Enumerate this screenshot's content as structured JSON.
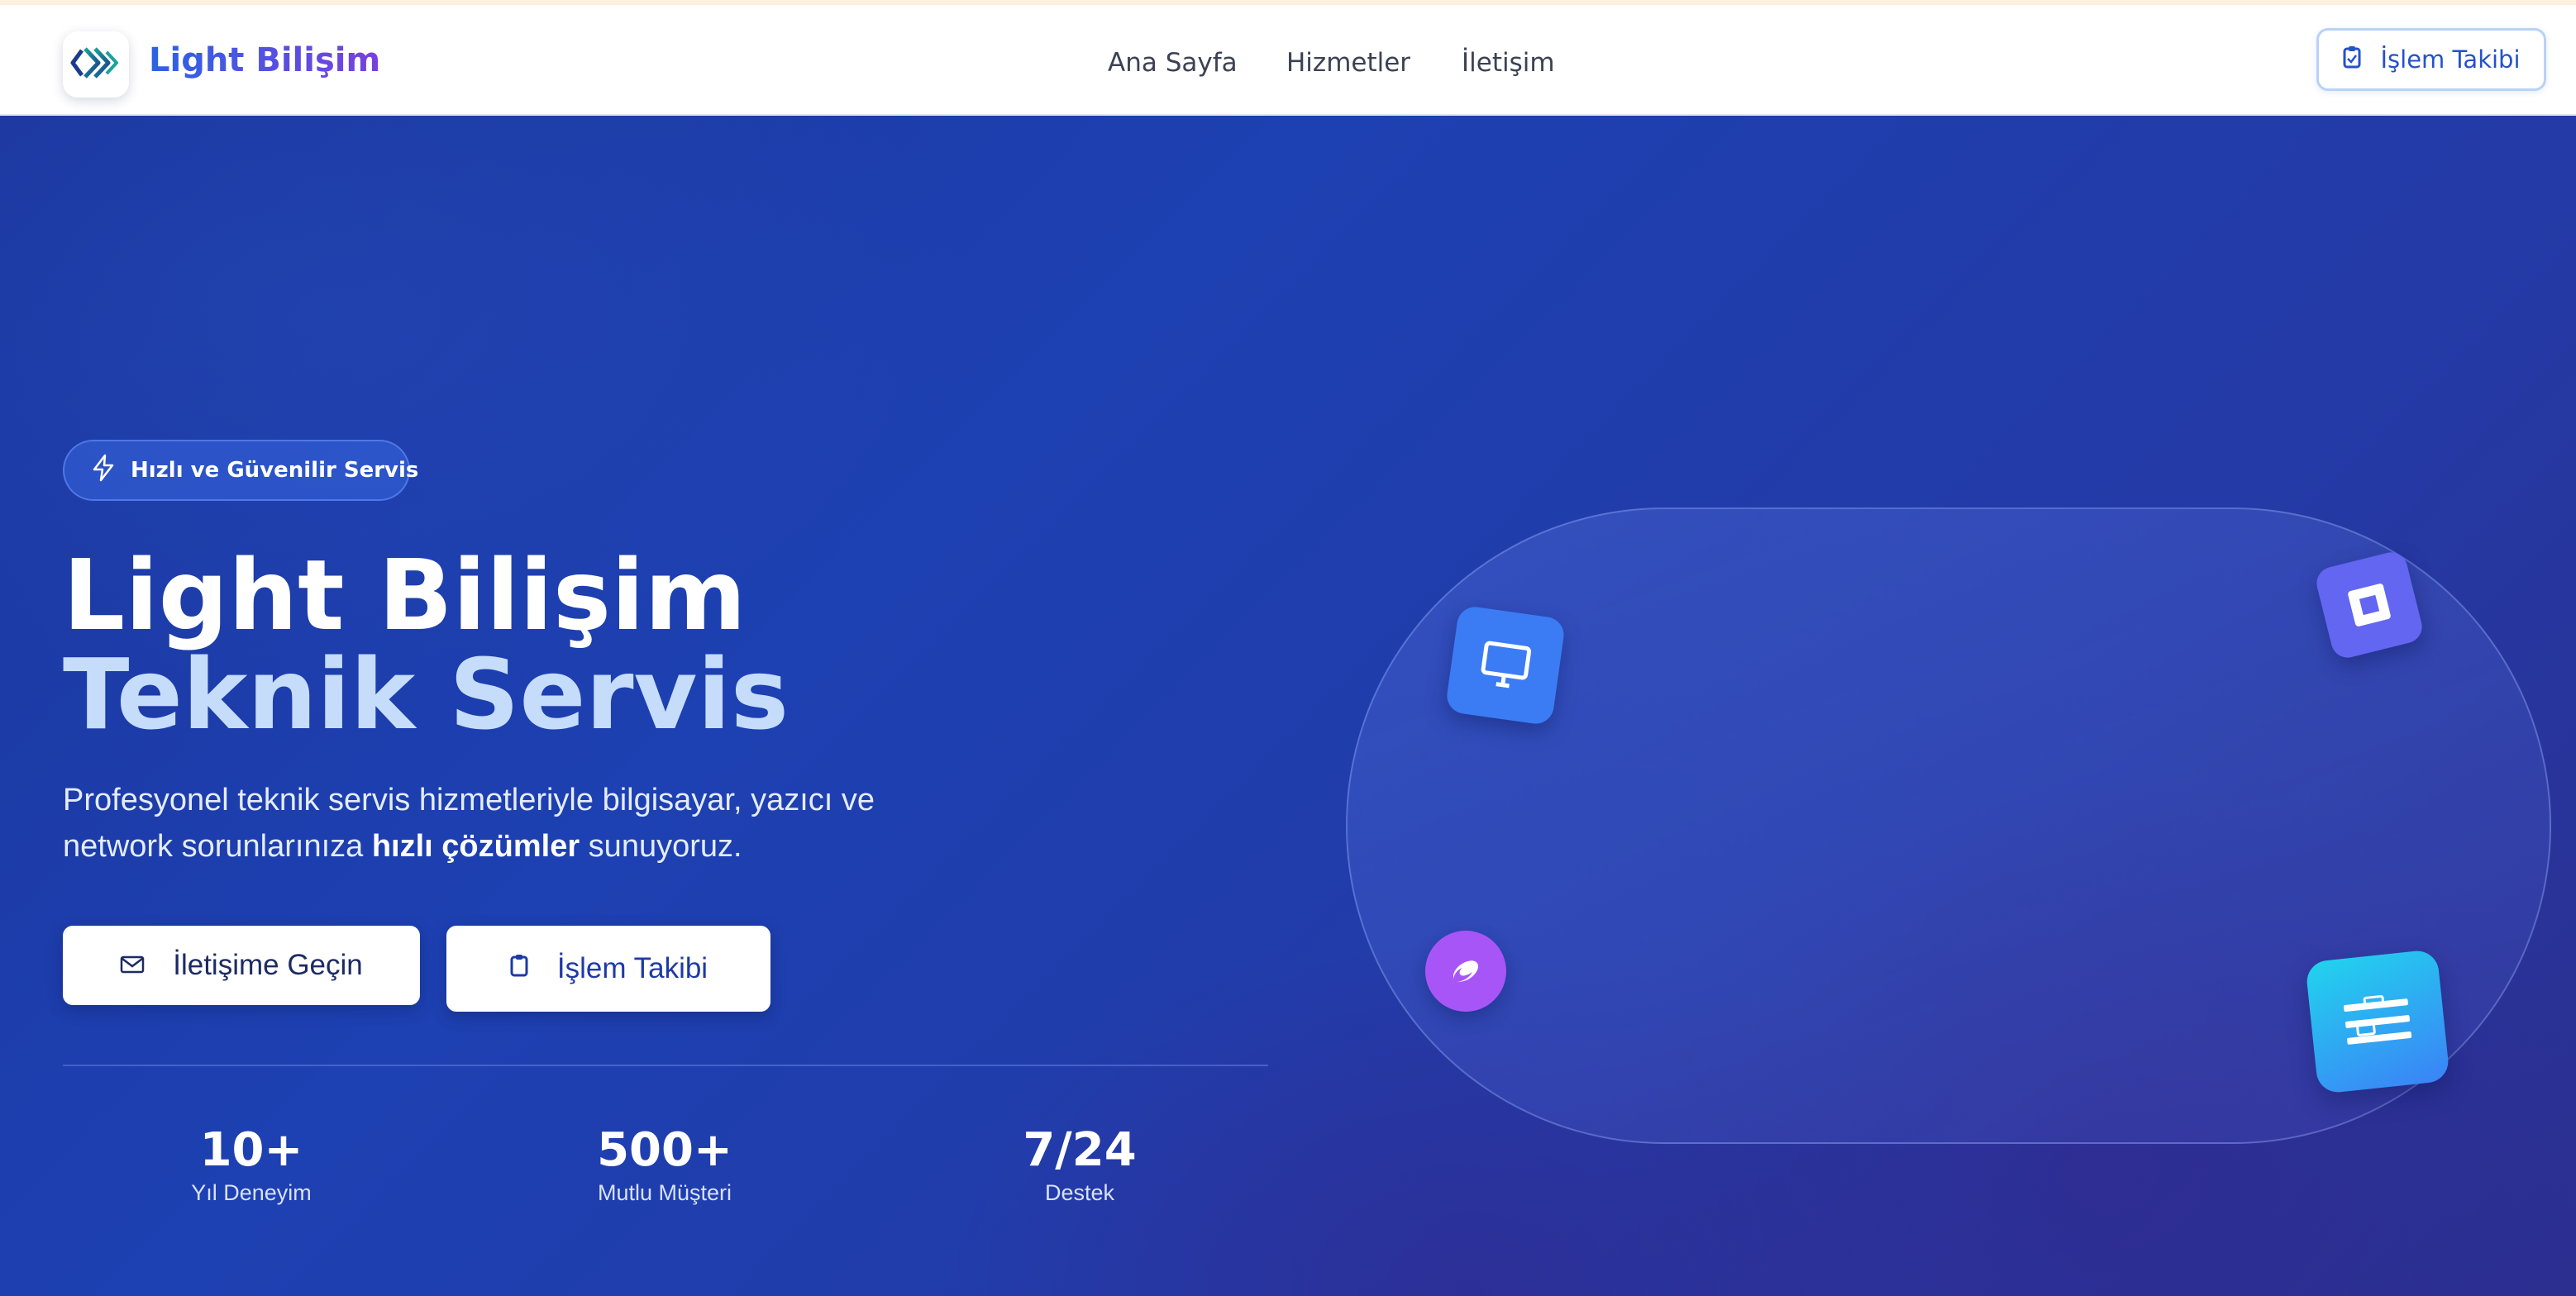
{
  "brand": {
    "name": "Light Bilişim"
  },
  "nav": {
    "links": [
      "Ana Sayfa",
      "Hizmetler",
      "İletişim"
    ],
    "track_button": "İşlem Takibi"
  },
  "hero": {
    "badge": "Hızlı ve Güvenilir Servis",
    "title_line1": "Light Bilişim",
    "title_line2": "Teknik Servis",
    "desc_part1": "Profesyonel teknik servis hizmetleriyle bilgisayar, yazıcı ve network sorunlarınıza ",
    "desc_bold": "hızlı çözümler",
    "desc_part2": " sunuyoruz.",
    "contact_button": "İletişime Geçin",
    "track_button": "İşlem Takibi"
  },
  "stats": [
    {
      "value": "10+",
      "label": "Yıl Deneyim"
    },
    {
      "value": "500+",
      "label": "Mutlu Müşteri"
    },
    {
      "value": "7/24",
      "label": "Destek"
    }
  ],
  "icons": {
    "logo": "diamond-logo-icon",
    "nav_track": "clipboard-icon",
    "badge": "lightning-icon",
    "contact": "mail-icon",
    "track": "clipboard-icon",
    "floating": [
      "monitor-icon",
      "chip-icon",
      "disc-icon",
      "server-icon"
    ]
  },
  "colors": {
    "accent": "#2b63e6",
    "brand_gradient_end": "#7a3fe0",
    "hero_bg": "#1d3aa6",
    "monitor_tile": "#3b7cf5",
    "chip_tile": "#6366f1",
    "disc_tile": "#a855f7",
    "server_tile": "#22d3ee"
  }
}
